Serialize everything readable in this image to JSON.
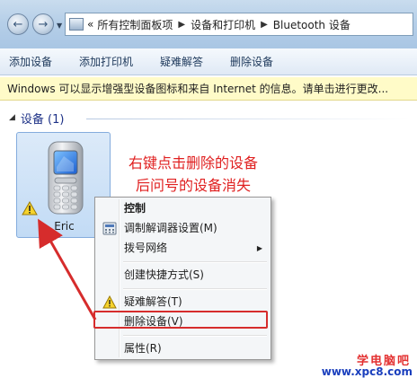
{
  "address_bar": {
    "overflow_marker": "«",
    "breadcrumbs": [
      "所有控制面板项",
      "设备和打印机",
      "Bluetooth 设备"
    ]
  },
  "toolbar": {
    "items": [
      "添加设备",
      "添加打印机",
      "疑难解答",
      "删除设备"
    ]
  },
  "infobar": {
    "text": "Windows 可以显示增强型设备图标和来自 Internet 的信息。请单击进行更改..."
  },
  "group": {
    "title": "设备 (1)"
  },
  "device": {
    "name": "Eric"
  },
  "annotation": {
    "line1": "右键点击删除的设备",
    "line2": "后问号的设备消失"
  },
  "context_menu": {
    "items": [
      {
        "label": "控制"
      },
      {
        "label": "调制解调器设置(M)"
      },
      {
        "label": "拨号网络"
      },
      {
        "label": "创建快捷方式(S)"
      },
      {
        "label": "疑难解答(T)"
      },
      {
        "label": "删除设备(V)"
      },
      {
        "label": "属性(R)"
      }
    ]
  },
  "watermark": {
    "title": "学电脑吧",
    "url": "www.xpc8.com"
  },
  "colors": {
    "annotation": "#e02020",
    "highlight": "#d62c2c",
    "selection_tile": "#c2dbf5"
  }
}
